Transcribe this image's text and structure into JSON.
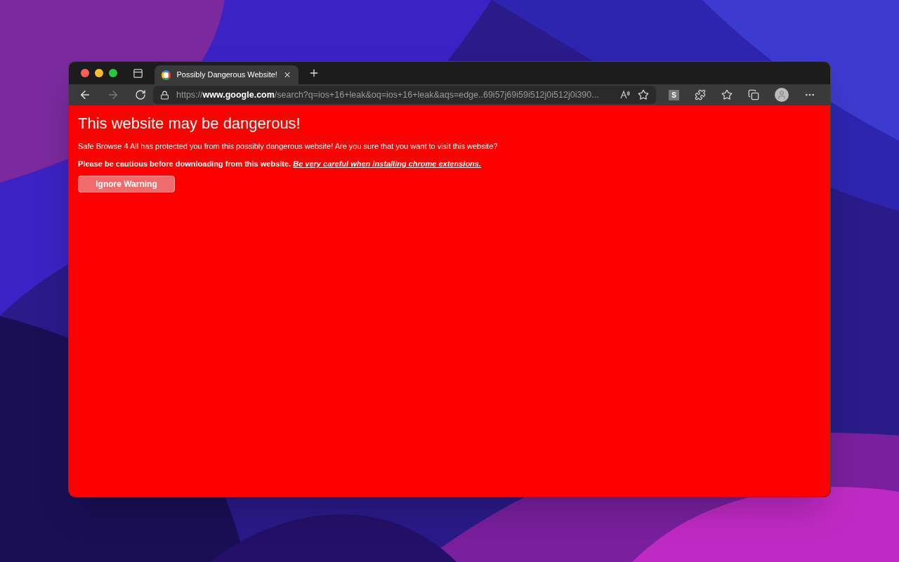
{
  "browser": {
    "tabs": [
      {
        "title": "Possibly Dangerous Website!",
        "selected": true
      }
    ],
    "address": {
      "scheme": "https://",
      "host": "www.google.com",
      "path": "/search?q=ios+16+leak&oq=ios+16+leak&aqs=edge..69i57j69i59i512j0i512j0i390..."
    },
    "extension_badge": "S"
  },
  "page": {
    "heading": "This website may be dangerous!",
    "message": "Safe Browse 4 All has protected you from this possibly dangerous website! Are you sure that you want to visit this website?",
    "caution": "Please be cautious before downloading from this website.",
    "caution_link": "Be very careful when installing chrome extensions.",
    "button": "Ignore Warning"
  }
}
